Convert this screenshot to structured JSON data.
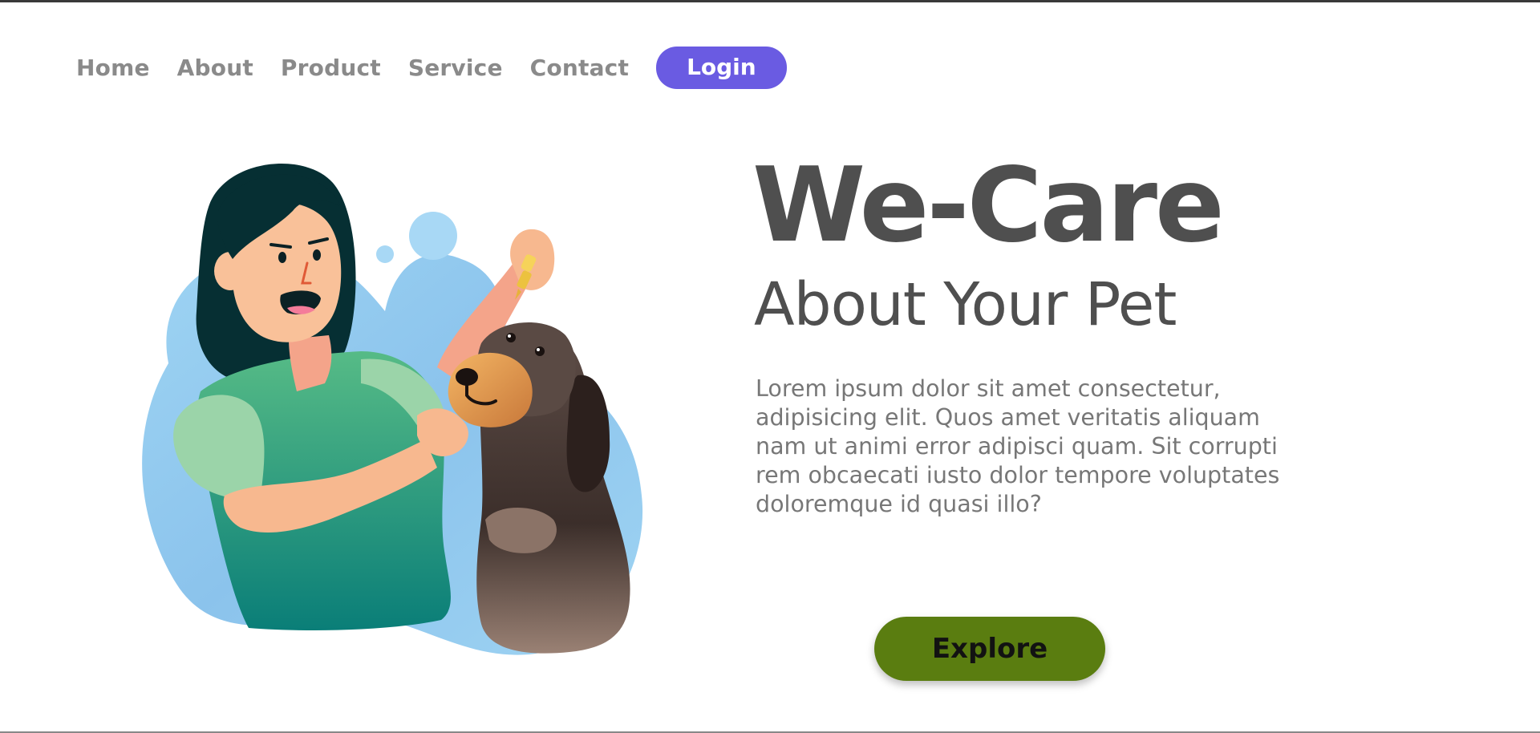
{
  "nav": {
    "items": [
      {
        "label": "Home"
      },
      {
        "label": "About"
      },
      {
        "label": "Product"
      },
      {
        "label": "Service"
      },
      {
        "label": "Contact"
      }
    ],
    "login_label": "Login"
  },
  "hero": {
    "title": "We-Care",
    "subtitle": "About Your Pet",
    "description": "Lorem ipsum dolor sit amet consectetur, adipisicing elit. Quos amet veritatis aliquam nam ut animi error adipisci quam. Sit corrupti rem obcaecati iusto dolor tempore voluptates doloremque id quasi illo?",
    "explore_label": "Explore"
  },
  "illustration": {
    "icon": "woman-with-dog-illustration"
  },
  "colors": {
    "accent": "#6a5be2",
    "explore": "#5a7d10",
    "heading": "#4f4f4f",
    "nav_text": "#8a8a8a",
    "blob": "#8ec8ef"
  }
}
